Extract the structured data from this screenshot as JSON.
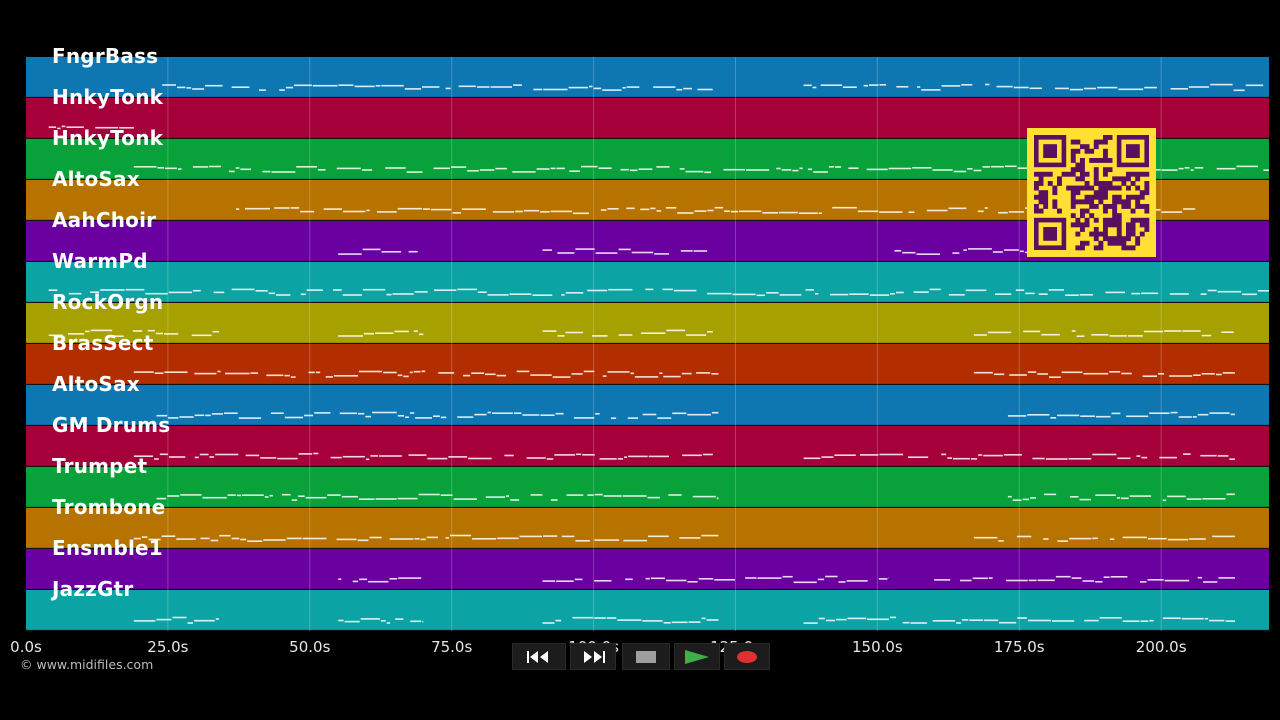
{
  "tracks": [
    {
      "name": "FngrBass",
      "color": "#0e77b2"
    },
    {
      "name": "HnkyTonk",
      "color": "#a5003a"
    },
    {
      "name": "HnkyTonk",
      "color": "#08a13a"
    },
    {
      "name": "AltoSax",
      "color": "#b77300"
    },
    {
      "name": "AahChoir",
      "color": "#6a009f"
    },
    {
      "name": "WarmPd",
      "color": "#0ba3a3"
    },
    {
      "name": "RockOrgn",
      "color": "#a6a000"
    },
    {
      "name": "BrasSect",
      "color": "#b22e00"
    },
    {
      "name": "AltoSax",
      "color": "#0e77b2"
    },
    {
      "name": "GM Drums",
      "color": "#a5003a"
    },
    {
      "name": "Trumpet",
      "color": "#08a13a"
    },
    {
      "name": "Trombone",
      "color": "#b77300"
    },
    {
      "name": "Ensmble1",
      "color": "#6a009f"
    },
    {
      "name": "JazzGtr",
      "color": "#0ba3a3"
    }
  ],
  "time_axis": {
    "max_seconds": 219,
    "ticks": [
      {
        "t": 0,
        "label": "0.0s"
      },
      {
        "t": 25,
        "label": "25.0s"
      },
      {
        "t": 50,
        "label": "50.0s"
      },
      {
        "t": 75,
        "label": "75.0s"
      },
      {
        "t": 100,
        "label": "100.0s"
      },
      {
        "t": 125,
        "label": "125.0s"
      },
      {
        "t": 150,
        "label": "150.0s"
      },
      {
        "t": 175,
        "label": "175.0s"
      },
      {
        "t": 200,
        "label": "200.0s"
      }
    ]
  },
  "note_segments": [
    [
      [
        24,
        121
      ],
      [
        137,
        219
      ]
    ],
    [
      [
        4,
        19
      ]
    ],
    [
      [
        19,
        219
      ]
    ],
    [
      [
        37,
        206
      ]
    ],
    [
      [
        55,
        69
      ],
      [
        91,
        120
      ],
      [
        153,
        180
      ]
    ],
    [
      [
        4,
        219
      ]
    ],
    [
      [
        4,
        34
      ],
      [
        55,
        70
      ],
      [
        91,
        121
      ],
      [
        167,
        213
      ]
    ],
    [
      [
        19,
        122
      ],
      [
        167,
        213
      ]
    ],
    [
      [
        23,
        122
      ],
      [
        173,
        213
      ]
    ],
    [
      [
        19,
        122
      ],
      [
        137,
        213
      ]
    ],
    [
      [
        23,
        122
      ],
      [
        173,
        213
      ]
    ],
    [
      [
        19,
        122
      ],
      [
        167,
        213
      ]
    ],
    [
      [
        55,
        70
      ],
      [
        91,
        152
      ],
      [
        160,
        213
      ]
    ],
    [
      [
        19,
        34
      ],
      [
        55,
        70
      ],
      [
        91,
        122
      ],
      [
        137,
        213
      ]
    ]
  ],
  "copyright": "© www.midifiles.com",
  "transport": {
    "rewind": "rewind-icon",
    "fast_forward": "fast-forward-icon",
    "stop": "stop-icon",
    "play": "play-icon",
    "record": "record-icon"
  },
  "colors": {
    "qr_bg": "#ffe033",
    "qr_fg": "#5a1060",
    "play_green": "#3fae49",
    "record_red": "#e03030"
  }
}
